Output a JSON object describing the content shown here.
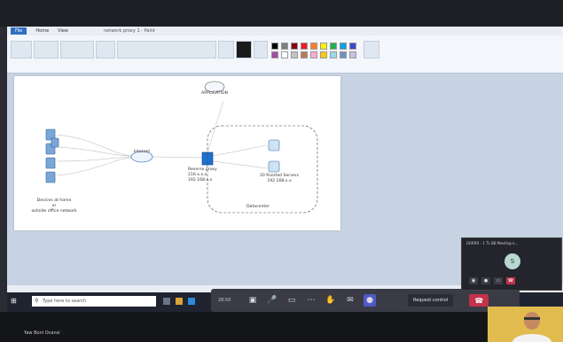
{
  "paint": {
    "tabs": [
      "File",
      "Home",
      "View"
    ],
    "window_title": "network proxy 1 - Paint",
    "palette": [
      "#000000",
      "#7f7f7f",
      "#880015",
      "#ed1c24",
      "#ff7f27",
      "#fff200",
      "#22b14c",
      "#00a2e8",
      "#3f48cc",
      "#a349a4",
      "#ffffff",
      "#c3c3c3",
      "#b97a57",
      "#ffaec9",
      "#ffc90e",
      "#99d9ea",
      "#7092be",
      "#c8bfe7"
    ]
  },
  "diagram": {
    "devices_label": [
      "Devices at home",
      "or",
      "outside office network"
    ],
    "cloud_internet_label": "Internet",
    "app_cloud_label": "APPLICATION",
    "reverse_proxy_label": [
      "Reverse proxy",
      "216.x.x.x",
      "192.168.x.x"
    ],
    "servers_label": [
      "20 Rsorted Servers",
      "192.168.x.x"
    ],
    "boundary_label": "Datacenter"
  },
  "teams": {
    "timer": "28:50",
    "request_control": "Request control",
    "mini_title": "GRRRR - 1 TL 6B Meeting n...",
    "participant_initial": "S"
  },
  "taskbar": {
    "search_placeholder": "Type here to search"
  },
  "bottom_text": "Yaw Boni Ocansi",
  "colors": {
    "accent": "#2f6fc1",
    "leave": "#c4314b",
    "teams_bar": "#3a3b45"
  }
}
